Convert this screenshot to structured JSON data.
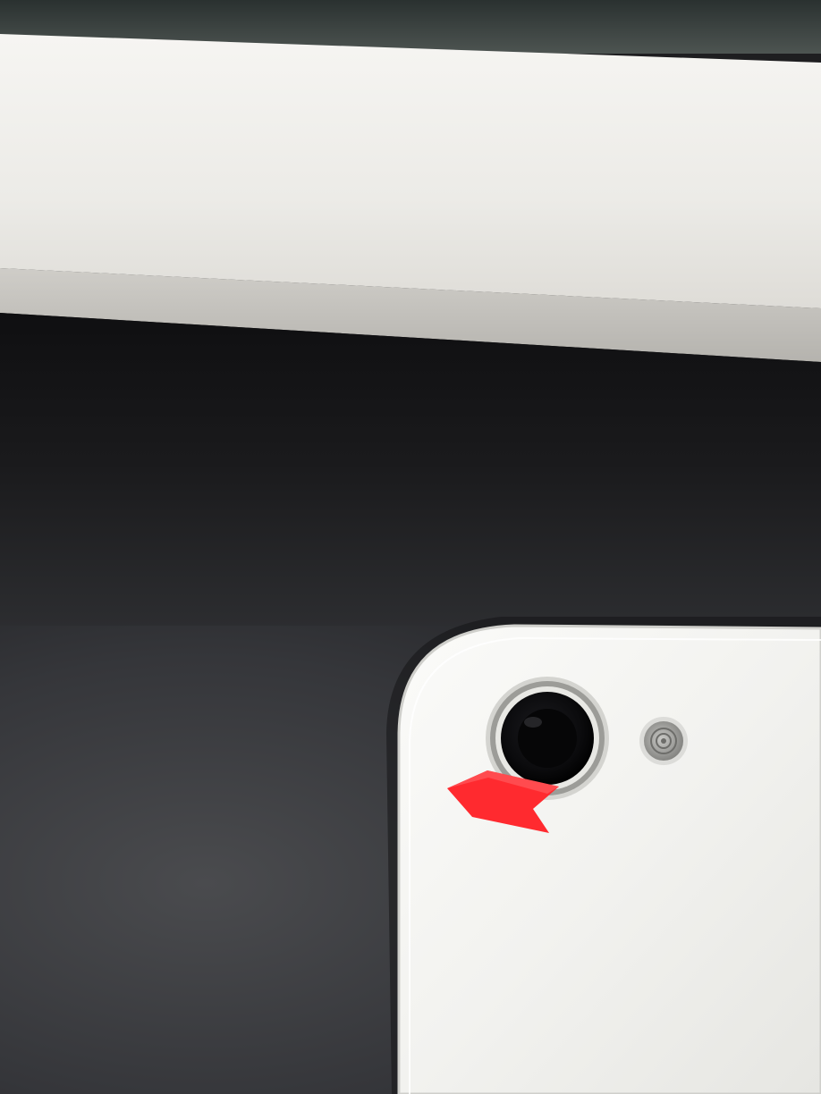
{
  "photo": {
    "subject": "phone-back-camera-closeup",
    "objects": [
      {
        "name": "white-shelf-board",
        "color": "#e9e7e2"
      },
      {
        "name": "dark-shadow-under-shelf",
        "color": "#141416"
      },
      {
        "name": "grey-surface",
        "color": "#3a3b3e"
      },
      {
        "name": "phone-back-panel",
        "color": "#f3f3f1"
      },
      {
        "name": "camera-lens",
        "ring_color": "#b8b8b4",
        "lens_color": "#0e0e10"
      },
      {
        "name": "flash-sensor",
        "color": "#9a9a98"
      },
      {
        "name": "red-arrow-sticker",
        "color": "#ff2a2f"
      }
    ]
  }
}
